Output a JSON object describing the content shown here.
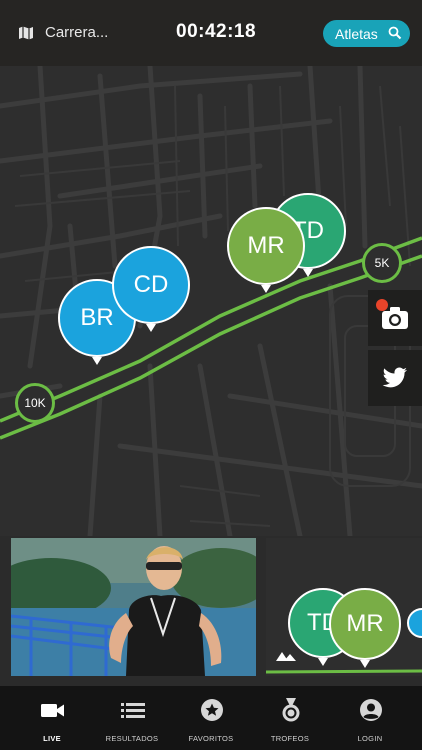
{
  "header": {
    "race_name": "Carrera...",
    "timer": "00:42:18",
    "athletes_button": "Atletas"
  },
  "map": {
    "route_color": "#6cbd45",
    "km_markers": [
      "5K",
      "10K"
    ],
    "athletes": [
      {
        "initials": "BR",
        "color": "#1ba3dd"
      },
      {
        "initials": "CD",
        "color": "#1ba3dd"
      },
      {
        "initials": "TD",
        "color": "#2aa673"
      },
      {
        "initials": "MR",
        "color": "#79ad46"
      }
    ]
  },
  "side_buttons": [
    "camera-icon",
    "twitter-icon"
  ],
  "mini_map": {
    "athletes": [
      {
        "initials": "TD",
        "color": "#2aa673"
      },
      {
        "initials": "MR",
        "color": "#79ad46"
      }
    ]
  },
  "tabs": [
    {
      "label": "LIVE",
      "icon": "video-camera-icon",
      "active": true
    },
    {
      "label": "RESULTADOS",
      "icon": "list-icon",
      "active": false
    },
    {
      "label": "FAVORITOS",
      "icon": "star-icon",
      "active": false
    },
    {
      "label": "TROFEOS",
      "icon": "medal-icon",
      "active": false
    },
    {
      "label": "LOGIN",
      "icon": "user-icon",
      "active": false
    }
  ],
  "colors": {
    "accent": "#19a3b8",
    "background": "#2e2e2e",
    "notification_dot": "#e8442a"
  }
}
